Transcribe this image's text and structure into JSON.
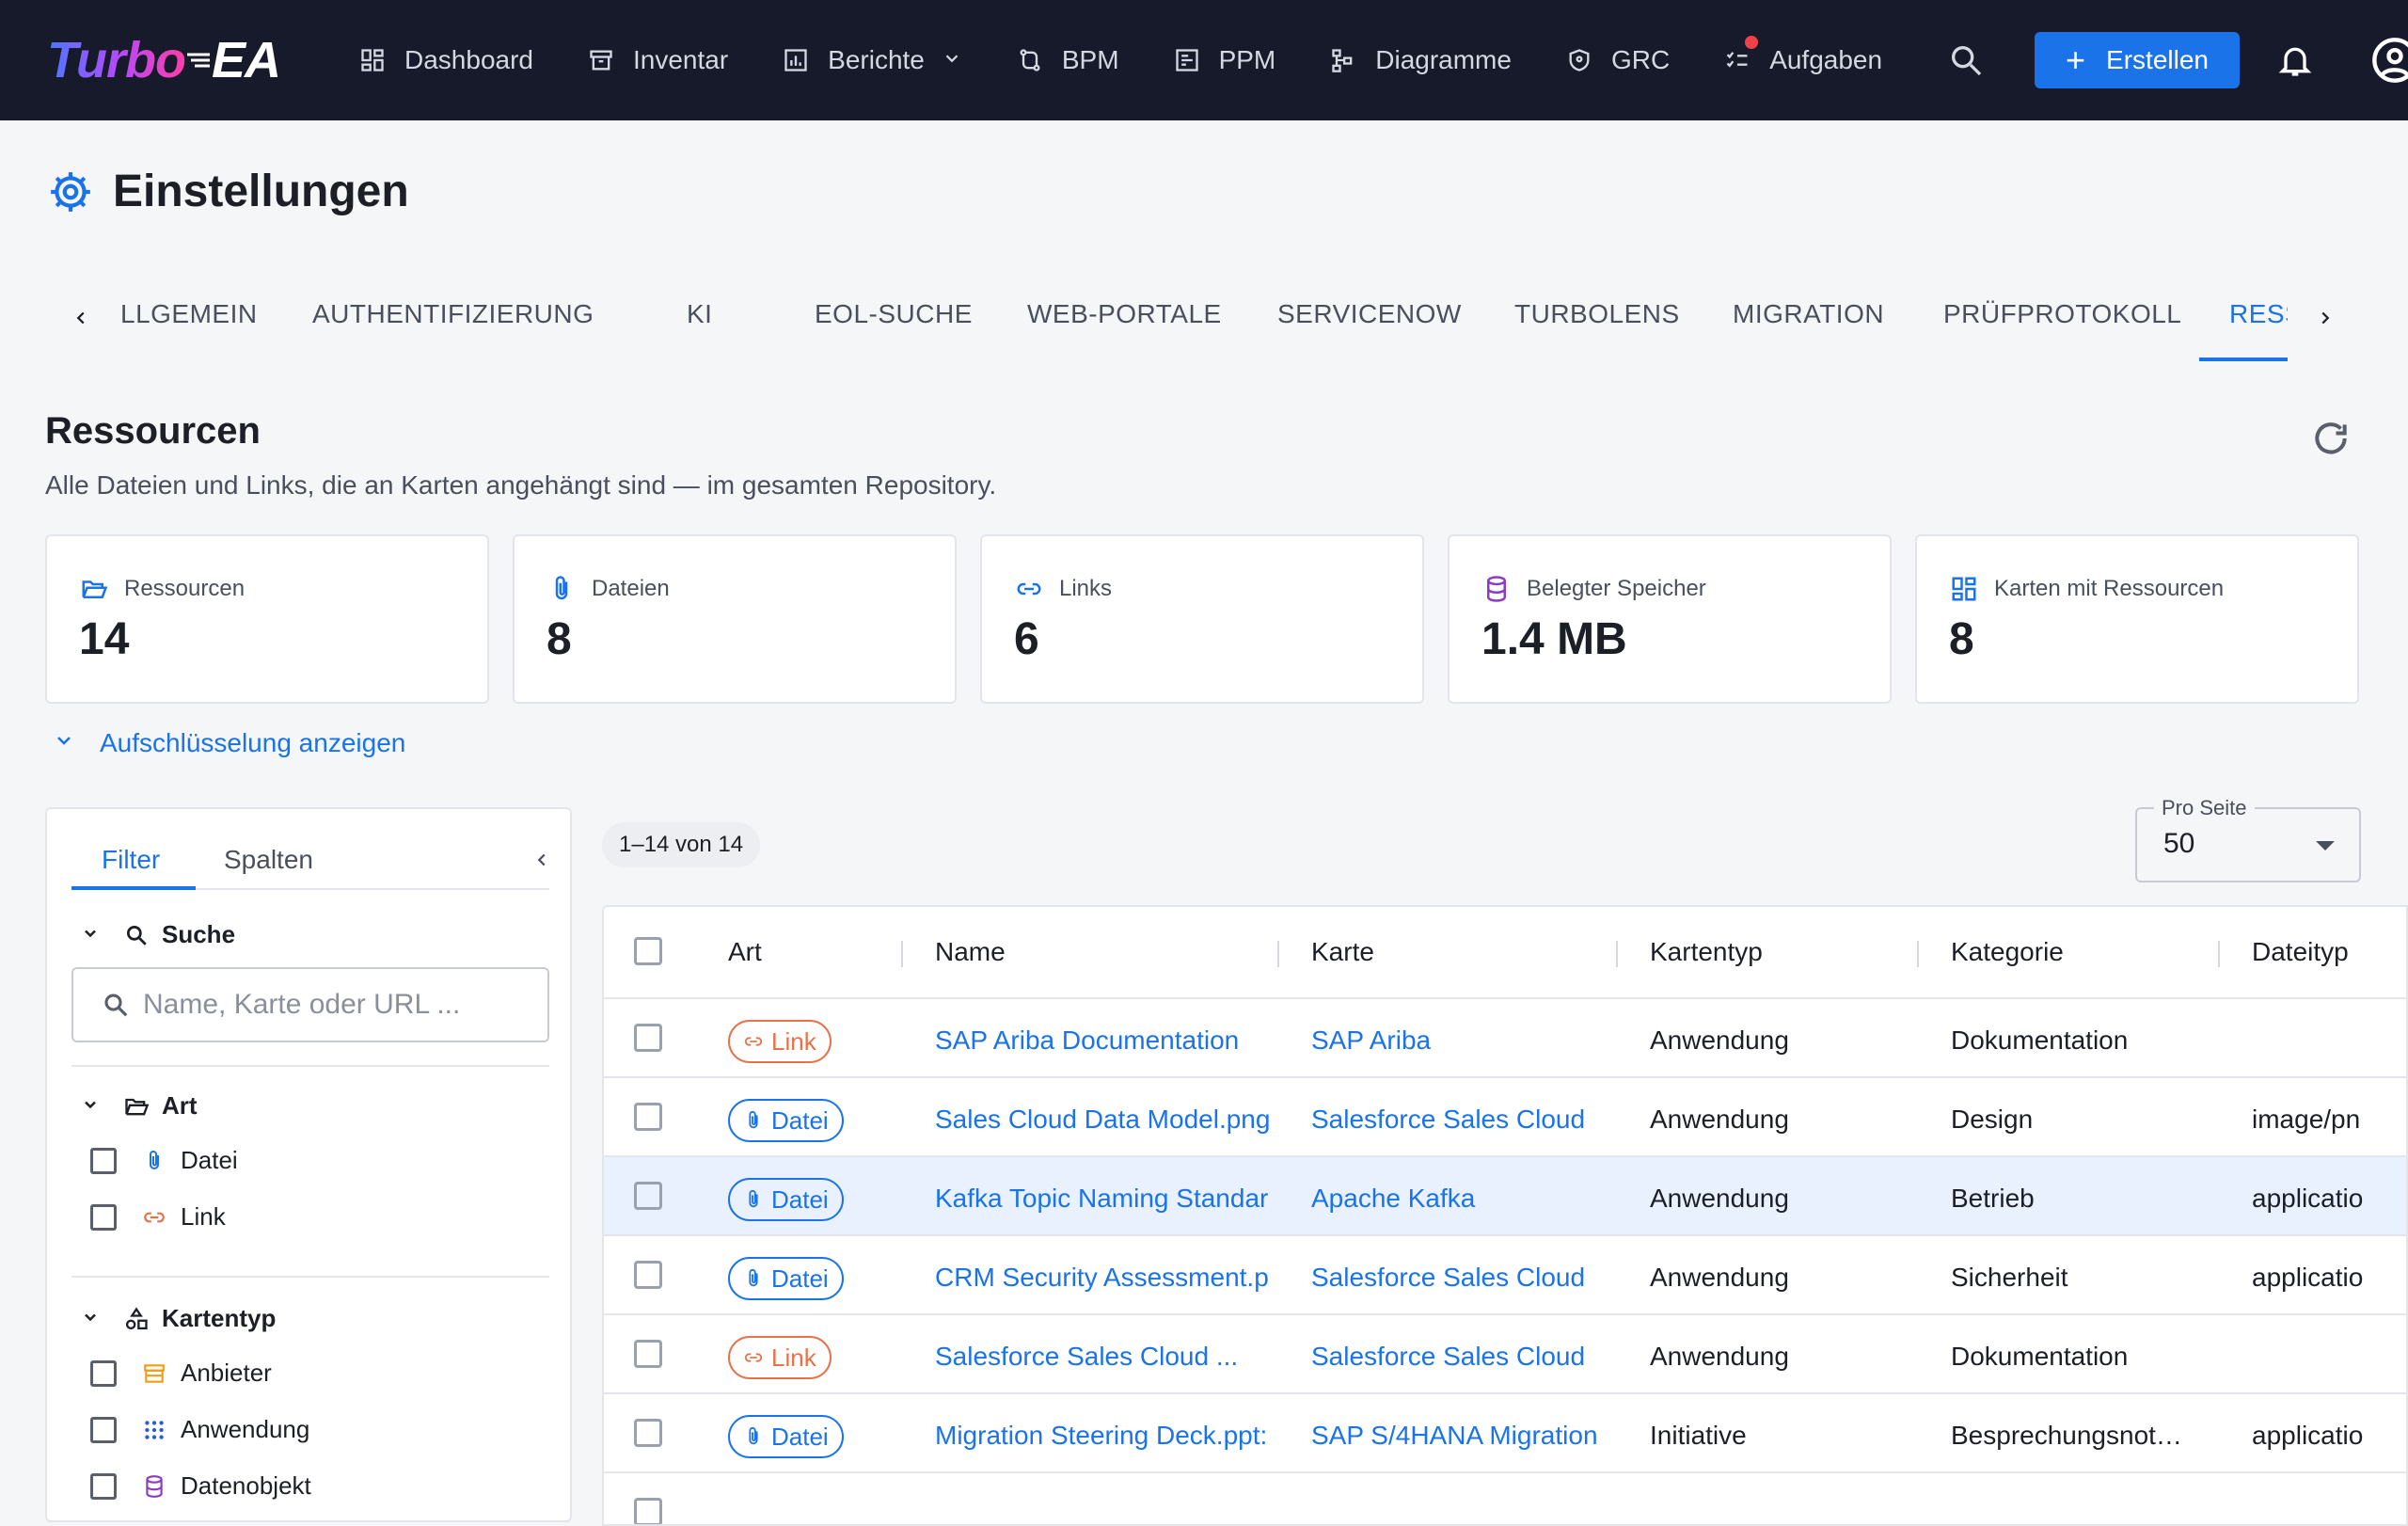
{
  "topbar": {
    "logo_turbo": "Turbo",
    "logo_ea": "EA",
    "nav": [
      {
        "label": "Dashboard"
      },
      {
        "label": "Inventar"
      },
      {
        "label": "Berichte"
      },
      {
        "label": "BPM"
      },
      {
        "label": "PPM"
      },
      {
        "label": "Diagramme"
      },
      {
        "label": "GRC"
      },
      {
        "label": "Aufgaben"
      }
    ],
    "create_label": "Erstellen"
  },
  "page": {
    "title": "Einstellungen"
  },
  "tabs": [
    "LLGEMEIN",
    "AUTHENTIFIZIERUNG",
    "KI",
    "EOL-SUCHE",
    "WEB-PORTALE",
    "SERVICENOW",
    "TURBOLENS",
    "MIGRATION",
    "PRÜFPROTOKOLL",
    "RESS"
  ],
  "section": {
    "title": "Ressourcen",
    "subtitle": "Alle Dateien und Links, die an Karten angehängt sind — im gesamten Repository."
  },
  "stats": [
    {
      "label": "Ressourcen",
      "value": "14",
      "icon": "folder-open-icon"
    },
    {
      "label": "Dateien",
      "value": "8",
      "icon": "paperclip-icon"
    },
    {
      "label": "Links",
      "value": "6",
      "icon": "link-icon"
    },
    {
      "label": "Belegter Speicher",
      "value": "1.4 MB",
      "icon": "database-icon"
    },
    {
      "label": "Karten mit Ressourcen",
      "value": "8",
      "icon": "dashboard-grid-icon"
    }
  ],
  "breakdown_label": "Aufschlüsselung anzeigen",
  "filter": {
    "tab_filter": "Filter",
    "tab_columns": "Spalten",
    "search_section": "Suche",
    "search_placeholder": "Name, Karte oder URL ...",
    "type_section": "Art",
    "type_options": [
      "Datei",
      "Link"
    ],
    "cardtype_section": "Kartentyp",
    "cardtype_options": [
      "Anbieter",
      "Anwendung",
      "Datenobjekt"
    ]
  },
  "table": {
    "count": "1–14 von 14",
    "per_page_label": "Pro Seite",
    "per_page_value": "50",
    "columns": [
      "Art",
      "Name",
      "Karte",
      "Kartentyp",
      "Kategorie",
      "Dateityp"
    ],
    "rows": [
      {
        "art": "Link",
        "name": "SAP Ariba Documentation",
        "karte": "SAP Ariba",
        "kartentyp": "Anwendung",
        "kategorie": "Dokumentation",
        "dateityp": ""
      },
      {
        "art": "Datei",
        "name": "Sales Cloud Data Model.png",
        "karte": "Salesforce Sales Cloud",
        "kartentyp": "Anwendung",
        "kategorie": "Design",
        "dateityp": "image/pn"
      },
      {
        "art": "Datei",
        "name": "Kafka Topic Naming Standar",
        "karte": "Apache Kafka",
        "kartentyp": "Anwendung",
        "kategorie": "Betrieb",
        "dateityp": "applicatio"
      },
      {
        "art": "Datei",
        "name": "CRM Security Assessment.p",
        "karte": "Salesforce Sales Cloud",
        "kartentyp": "Anwendung",
        "kategorie": "Sicherheit",
        "dateityp": "applicatio"
      },
      {
        "art": "Link",
        "name": "Salesforce Sales Cloud ...",
        "karte": "Salesforce Sales Cloud",
        "kartentyp": "Anwendung",
        "kategorie": "Dokumentation",
        "dateityp": ""
      },
      {
        "art": "Datei",
        "name": "Migration Steering Deck.ppt:",
        "karte": "SAP S/4HANA Migration",
        "kartentyp": "Initiative",
        "kategorie": "Besprechungsnot…",
        "dateityp": "applicatio"
      }
    ]
  },
  "colors": {
    "accent": "#1a73e8",
    "topbar": "#171a2b",
    "link_chip": "#e8714a",
    "highlight_row": "#e8f1fd"
  }
}
